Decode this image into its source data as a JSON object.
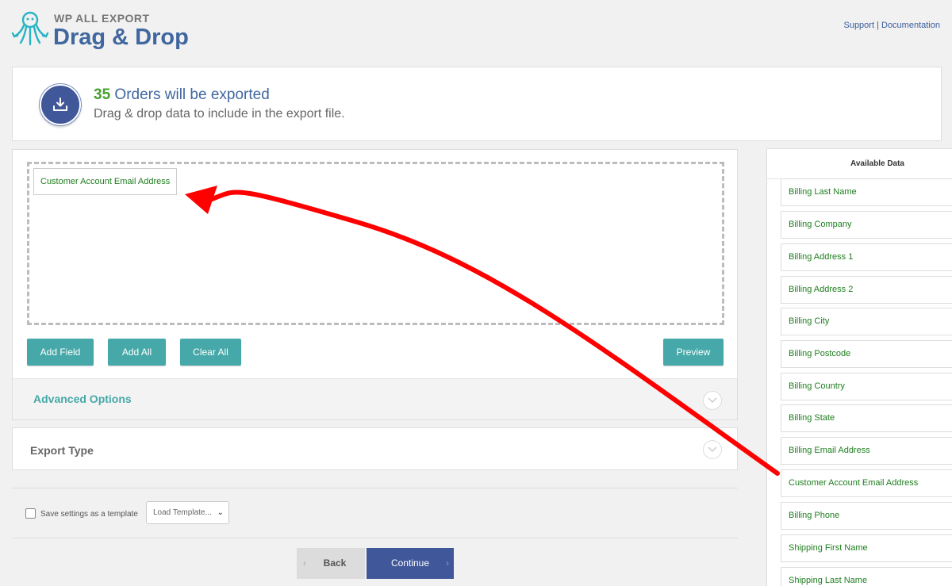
{
  "header": {
    "brand_small": "WP ALL EXPORT",
    "brand_big": "Drag & Drop",
    "support_link": "Support",
    "separator": "|",
    "docs_link": "Documentation"
  },
  "summary": {
    "count": "35",
    "title_rest": " Orders will be exported",
    "subtitle": "Drag & drop data to include in the export file."
  },
  "drop_zone": {
    "fields": [
      "Customer Account Email Address"
    ]
  },
  "buttons": {
    "add_field": "Add Field",
    "add_all": "Add All",
    "clear_all": "Clear All",
    "preview": "Preview"
  },
  "sections": {
    "advanced_options": "Advanced Options",
    "export_type": "Export Type"
  },
  "template": {
    "save_label": "Save settings as a template",
    "select_value": "Load Template..."
  },
  "nav": {
    "back": "Back",
    "continue": "Continue"
  },
  "sidebar": {
    "title": "Available Data",
    "items": [
      "Billing Last Name",
      "Billing Company",
      "Billing Address 1",
      "Billing Address 2",
      "Billing City",
      "Billing Postcode",
      "Billing Country",
      "Billing State",
      "Billing Email Address",
      "Customer Account Email Address",
      "Billing Phone",
      "Shipping First Name",
      "Shipping Last Name"
    ]
  },
  "colors": {
    "accent_teal": "#46a8a8",
    "brand_blue": "#40579a",
    "field_green": "#1e7e1e",
    "annotation_red": "#ff0000"
  }
}
